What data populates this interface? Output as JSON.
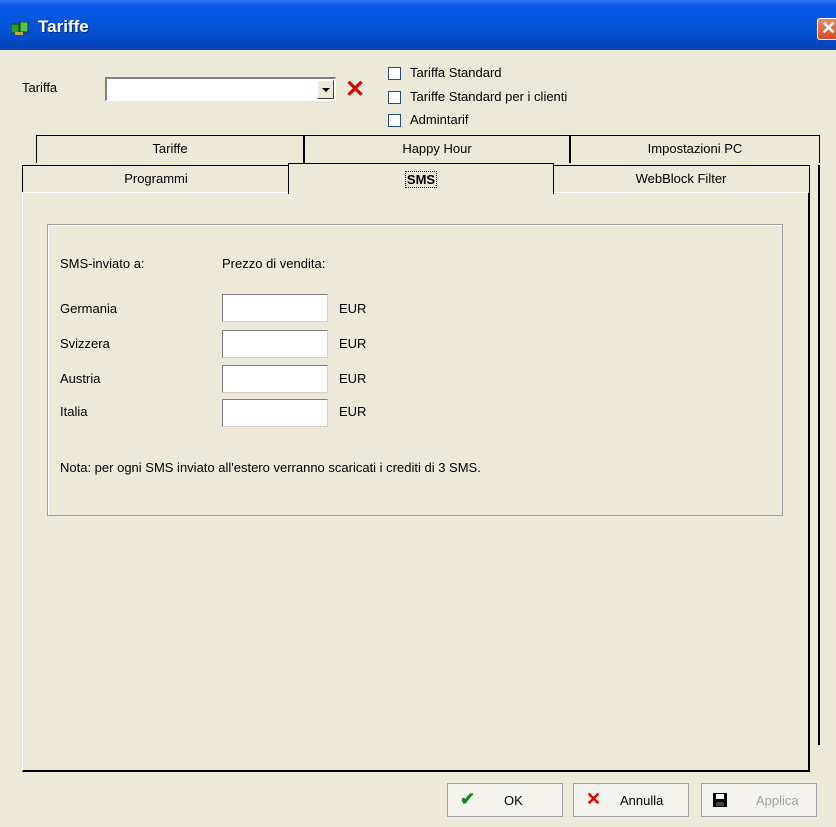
{
  "window": {
    "title": "Tariffe",
    "close_glyph": "✕",
    "icon": "app-icon"
  },
  "tariff_row": {
    "label": "Tariffa",
    "combo_value": "",
    "clear_glyph": "✕",
    "checkboxes": [
      {
        "label": "Tariffa Standard",
        "checked": false
      },
      {
        "label": "Tariffe Standard per i clienti",
        "checked": false
      },
      {
        "label": "Admintarif",
        "checked": false
      }
    ]
  },
  "tabs_back": [
    "Tariffe",
    "Happy Hour",
    "Impostazioni PC"
  ],
  "tabs_front": [
    "Programmi",
    "SMS",
    "WebBlock Filter"
  ],
  "active_tab": "SMS",
  "sms_panel": {
    "col_country": "SMS-inviato a:",
    "col_price": "Prezzo di vendita:",
    "rows": [
      {
        "country": "Germania",
        "value": "",
        "unit": "EUR"
      },
      {
        "country": "Svizzera",
        "value": "",
        "unit": "EUR"
      },
      {
        "country": "Austria",
        "value": "",
        "unit": "EUR"
      },
      {
        "country": "Italia",
        "value": "",
        "unit": "EUR"
      }
    ],
    "note": "Nota: per ogni SMS inviato all'estero verranno scaricati i crediti di 3 SMS."
  },
  "buttons": {
    "ok": {
      "label": "OK",
      "icon": "check-icon",
      "glyph": "✔",
      "color": "#1a8a1a"
    },
    "cancel": {
      "label": "Annulla",
      "icon": "cross-icon",
      "glyph": "✕",
      "color": "#e00000"
    },
    "apply": {
      "label": "Applica",
      "icon": "floppy-disk-icon",
      "enabled": false
    }
  }
}
